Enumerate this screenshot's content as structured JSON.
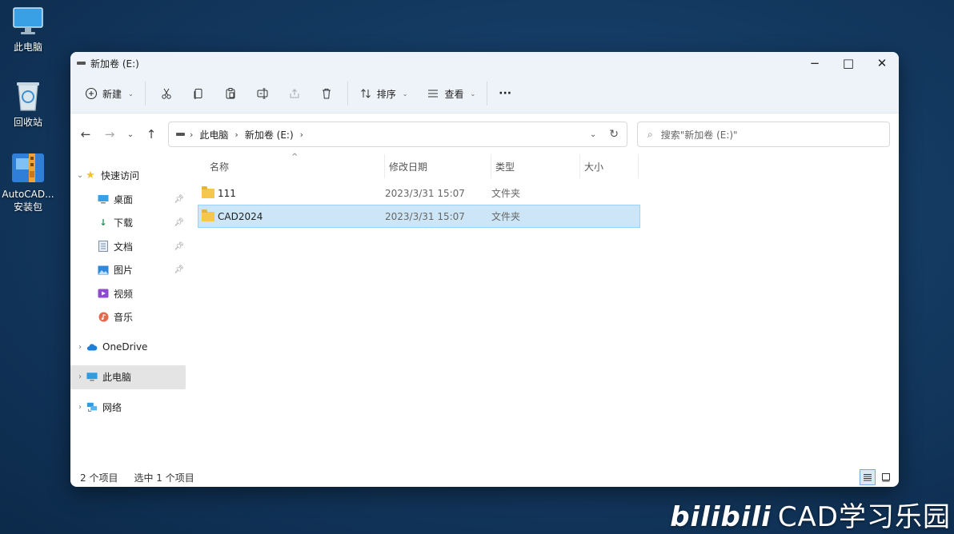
{
  "desktop": {
    "icons": [
      {
        "label": "此电脑"
      },
      {
        "label": "回收站"
      },
      {
        "label": "AutoCAD...",
        "label2": "安装包"
      }
    ]
  },
  "window": {
    "title": "新加卷 (E:)",
    "controls": {
      "minimize": "−",
      "maximize": "□",
      "close": "✕"
    }
  },
  "toolbar": {
    "new_label": "新建",
    "sort_label": "排序",
    "view_label": "查看",
    "more_label": "···"
  },
  "address": {
    "crumbs": [
      "此电脑",
      "新加卷 (E:)"
    ],
    "search_placeholder": "搜索\"新加卷 (E:)\""
  },
  "sidebar": {
    "quick_access": "快速访问",
    "items": [
      {
        "label": "桌面"
      },
      {
        "label": "下载"
      },
      {
        "label": "文档"
      },
      {
        "label": "图片"
      },
      {
        "label": "视频"
      },
      {
        "label": "音乐"
      }
    ],
    "onedrive": "OneDrive",
    "this_pc": "此电脑",
    "network": "网络"
  },
  "columns": [
    "名称",
    "修改日期",
    "类型",
    "大小"
  ],
  "files": [
    {
      "name": "111",
      "modified": "2023/3/31 15:07",
      "type": "文件夹",
      "size": ""
    },
    {
      "name": "CAD2024",
      "modified": "2023/3/31 15:07",
      "type": "文件夹",
      "size": ""
    }
  ],
  "status": {
    "count": "2 个项目",
    "selected": "选中 1 个项目"
  },
  "watermark": {
    "brand": "bilibili",
    "text": "CAD学习乐园"
  },
  "colors": {
    "selection": "#cde6f7",
    "selection_border": "#99d1ff",
    "folder": "#f5c74e"
  }
}
